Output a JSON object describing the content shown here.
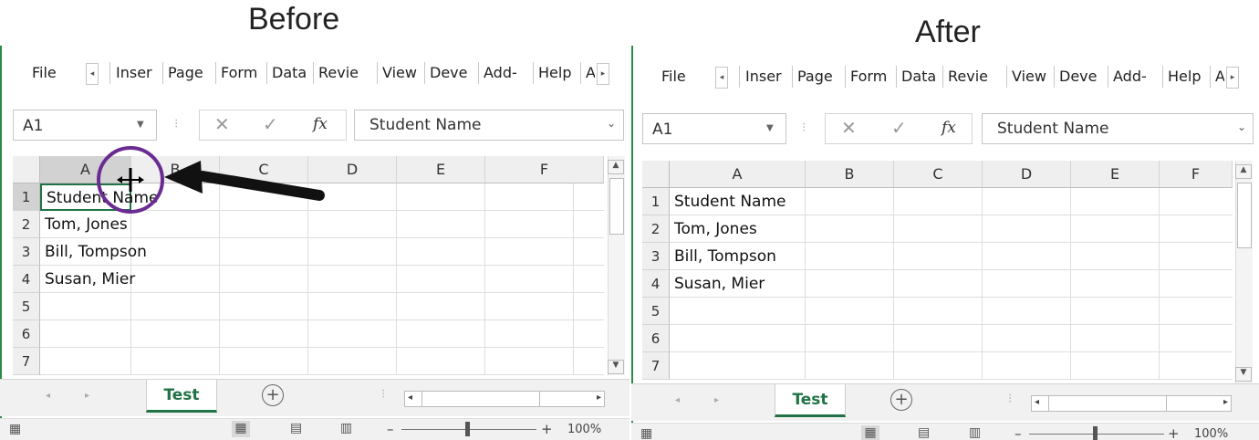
{
  "captions": {
    "before": "Before",
    "after": "After"
  },
  "ribbon_tabs": [
    "File",
    "Inser",
    "Page",
    "Form",
    "Data",
    "Revie",
    "View",
    "Deve",
    "Add-",
    "Help",
    "A"
  ],
  "formula_bar": {
    "name_box": "A1",
    "fx_label": "fx",
    "formula": "Student Name"
  },
  "columns": [
    "A",
    "B",
    "C",
    "D",
    "E",
    "F"
  ],
  "rows": [
    "1",
    "2",
    "3",
    "4",
    "5",
    "6",
    "7"
  ],
  "cells": [
    "Student Name",
    "Tom, Jones",
    "Bill, Tompson",
    "Susan, Mier"
  ],
  "sheet_tab": "Test",
  "zoom": "100%",
  "colors": {
    "accent": "#217346",
    "highlight_circle": "#6a2c91"
  }
}
